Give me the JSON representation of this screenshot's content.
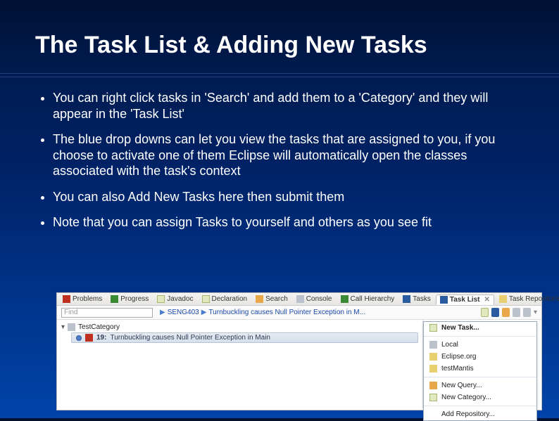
{
  "slide": {
    "title": "The Task List & Adding New Tasks",
    "bullets": [
      "You can right click tasks in 'Search' and add them to a 'Category' and they will appear in the 'Task List'",
      "The blue drop downs can let you view the tasks that are assigned to you, if you choose to activate one of them Eclipse will automatically open the classes associated with the task's context",
      "You can also Add New Tasks here then submit them",
      "Note that you can assign Tasks to yourself and others as you see fit"
    ]
  },
  "eclipse": {
    "tabs": [
      {
        "label": "Problems"
      },
      {
        "label": "Progress"
      },
      {
        "label": "Javadoc"
      },
      {
        "label": "Declaration"
      },
      {
        "label": "Search"
      },
      {
        "label": "Console"
      },
      {
        "label": "Call Hierarchy"
      },
      {
        "label": "Tasks"
      },
      {
        "label": "Task List"
      },
      {
        "label": "Task Repositories"
      }
    ],
    "active_tab_label": "Task List",
    "find_placeholder": "Find",
    "breadcrumb": {
      "group": "SENG403",
      "task": "Turnbuckling causes Null Pointer Exception in M..."
    },
    "tree": {
      "category": "TestCategory",
      "task_num": "19:",
      "task_title": "Turnbuckling causes Null Pointer Exception in Main"
    },
    "menu": {
      "new_task": "New Task...",
      "repos": [
        "Local",
        "Eclipse.org",
        "testMantis"
      ],
      "new_query": "New Query...",
      "new_category": "New Category...",
      "add_repo": "Add Repository..."
    }
  }
}
